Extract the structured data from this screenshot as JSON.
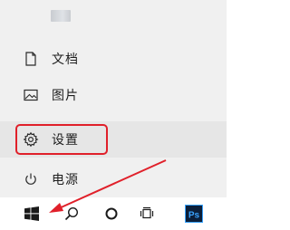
{
  "start_menu": {
    "items": [
      {
        "label": "文档",
        "icon": "document-icon"
      },
      {
        "label": "图片",
        "icon": "picture-icon"
      },
      {
        "label": "设置",
        "icon": "gear-icon"
      },
      {
        "label": "电源",
        "icon": "power-icon"
      }
    ],
    "highlighted_item": "设置"
  },
  "taskbar": {
    "buttons": [
      {
        "icon": "windows-start-icon"
      },
      {
        "icon": "search-icon"
      },
      {
        "icon": "cortana-icon"
      },
      {
        "icon": "task-view-icon"
      },
      {
        "icon": "photoshop-icon",
        "text": "Ps"
      }
    ]
  },
  "annotation_color": "#e0202a"
}
